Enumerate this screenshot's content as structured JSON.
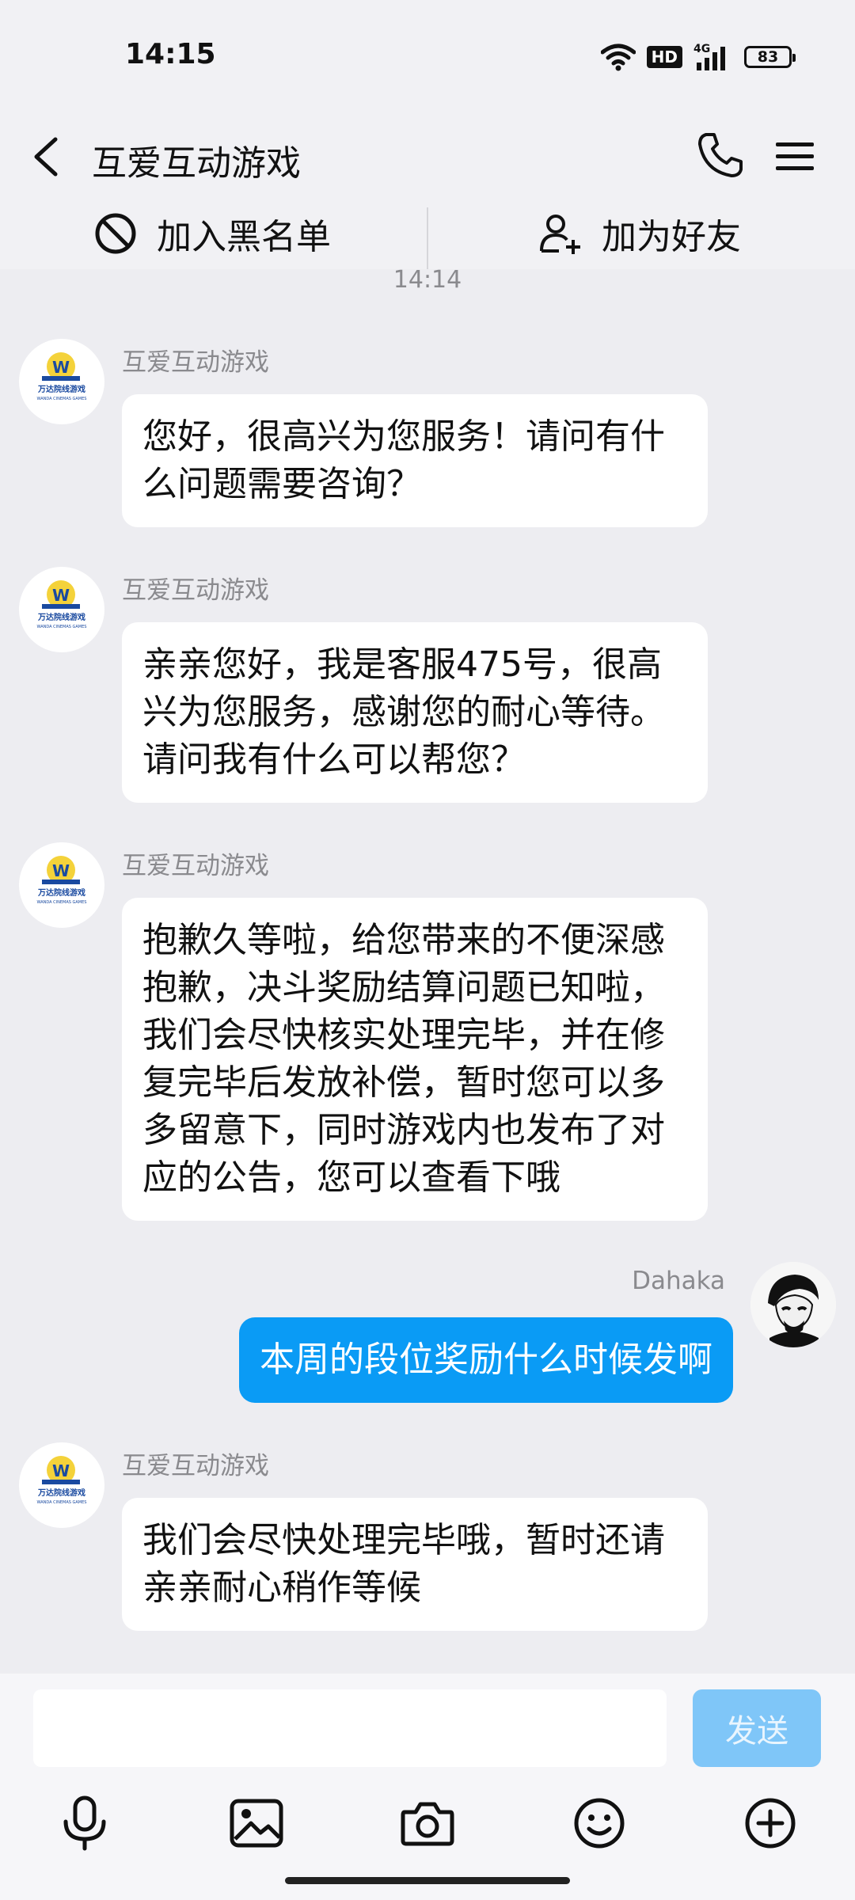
{
  "status_bar": {
    "time": "14:15",
    "network": "4G",
    "hd": "HD",
    "battery": "83"
  },
  "header": {
    "title": "互爱互动游戏"
  },
  "actions": {
    "blacklist_label": "加入黑名单",
    "add_friend_label": "加为好友"
  },
  "timestamp": "14:14",
  "messages": [
    {
      "sender": "互爱互动游戏",
      "text": "您好，很高兴为您服务！请问有什么问题需要咨询？"
    },
    {
      "sender": "互爱互动游戏",
      "text": "亲亲您好，我是客服475号，很高兴为您服务，感谢您的耐心等待。请问我有什么可以帮您？"
    },
    {
      "sender": "互爱互动游戏",
      "text": "抱歉久等啦，给您带来的不便深感抱歉，决斗奖励结算问题已知啦，我们会尽快核实处理完毕，并在修复完毕后发放补偿，暂时您可以多多留意下，同时游戏内也发布了对应的公告，您可以查看下哦"
    },
    {
      "sender": "Dahaka",
      "text": "本周的段位奖励什么时候发啊"
    },
    {
      "sender": "互爱互动游戏",
      "text": "我们会尽快处理完毕哦，暂时还请亲亲耐心稍作等候"
    }
  ],
  "input": {
    "value": "",
    "placeholder": "",
    "send_label": "发送"
  },
  "bot_logo": {
    "line1": "万达院线游戏",
    "line2": "WANDA CINEMAS GAMES"
  },
  "colors": {
    "accent": "#0a9bf5",
    "send_disabled": "#7fc6f8",
    "background": "#ededf1"
  }
}
